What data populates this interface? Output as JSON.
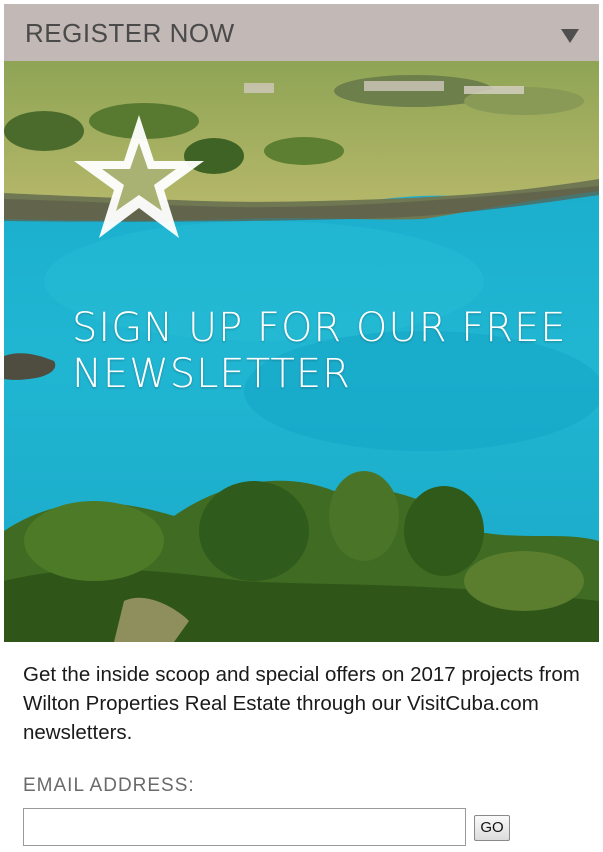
{
  "header": {
    "title": "REGISTER NOW",
    "toggle_icon": "triangle-down-icon"
  },
  "hero": {
    "logo_icon": "star-logo-icon",
    "headline": "SIGN UP FOR OUR FREE NEWSLETTER",
    "colors": {
      "sea": "#1fb3cf",
      "sea_deep": "#12a0c4",
      "land": "#a9b25b",
      "foliage": "#3f6b22"
    }
  },
  "intro": {
    "text": "Get the inside scoop and special offers on 2017 projects from Wilton Properties Real Estate through our VisitCuba.com newsletters."
  },
  "form": {
    "email_label": "EMAIL ADDRESS:",
    "email_value": "",
    "email_placeholder": "",
    "submit_label": "GO"
  },
  "colors": {
    "header_bg": "#c2b8b5",
    "header_text": "#4a4a4a",
    "label_text": "#6a6a6a"
  }
}
